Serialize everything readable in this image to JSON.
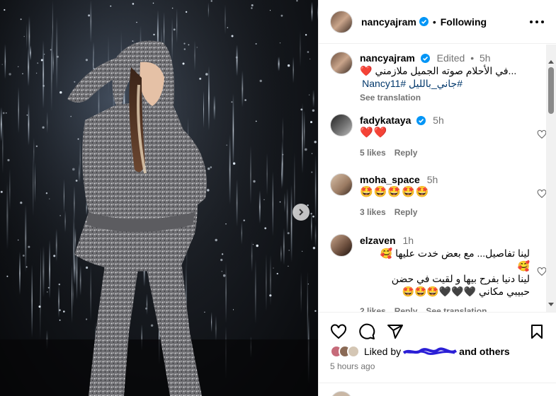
{
  "header": {
    "username": "nancyajram",
    "separator": "•",
    "follow_label": "Following"
  },
  "caption": {
    "username": "nancyajram",
    "edited": "Edited",
    "sep": "•",
    "time": "5h",
    "text": "...في الأحلام صوته الجميل ملازمني",
    "hashtags": "#جاني_بالليل #Nancy11",
    "see_translation": "See translation"
  },
  "comments": [
    {
      "username": "fadykataya",
      "time": "5h",
      "text": "❤️❤️",
      "likes": "5 likes",
      "reply": "Reply"
    },
    {
      "username": "moha_space",
      "time": "5h",
      "text": "🤩🤩🤩🤩🤩",
      "likes": "3 likes",
      "reply": "Reply"
    },
    {
      "username": "elzaven",
      "time": "1h",
      "text_line1": "لينا تفاصيل... مع بعض خدت عليها 🥰",
      "text_line2": "🥰",
      "text_line3": "لينا دنيا بفرح بيها و لقيت في حضن",
      "text_line4": "حبيبي مكاني 🖤🖤🖤🤩🤩🤩",
      "likes": "2 likes",
      "reply": "Reply",
      "see_translation": "See translation"
    }
  ],
  "likes_bar": {
    "liked_by": "Liked by",
    "and_others": "and others",
    "time_ago": "5 hours ago"
  },
  "icons": [
    "verified-badge-icon",
    "more-options-icon",
    "heart-icon",
    "comment-icon",
    "share-icon",
    "bookmark-icon",
    "chevron-right-icon"
  ],
  "colors": {
    "verified": "#0095f6",
    "link": "#00376b",
    "muted": "#737373",
    "redact": "#2b1fd6"
  }
}
